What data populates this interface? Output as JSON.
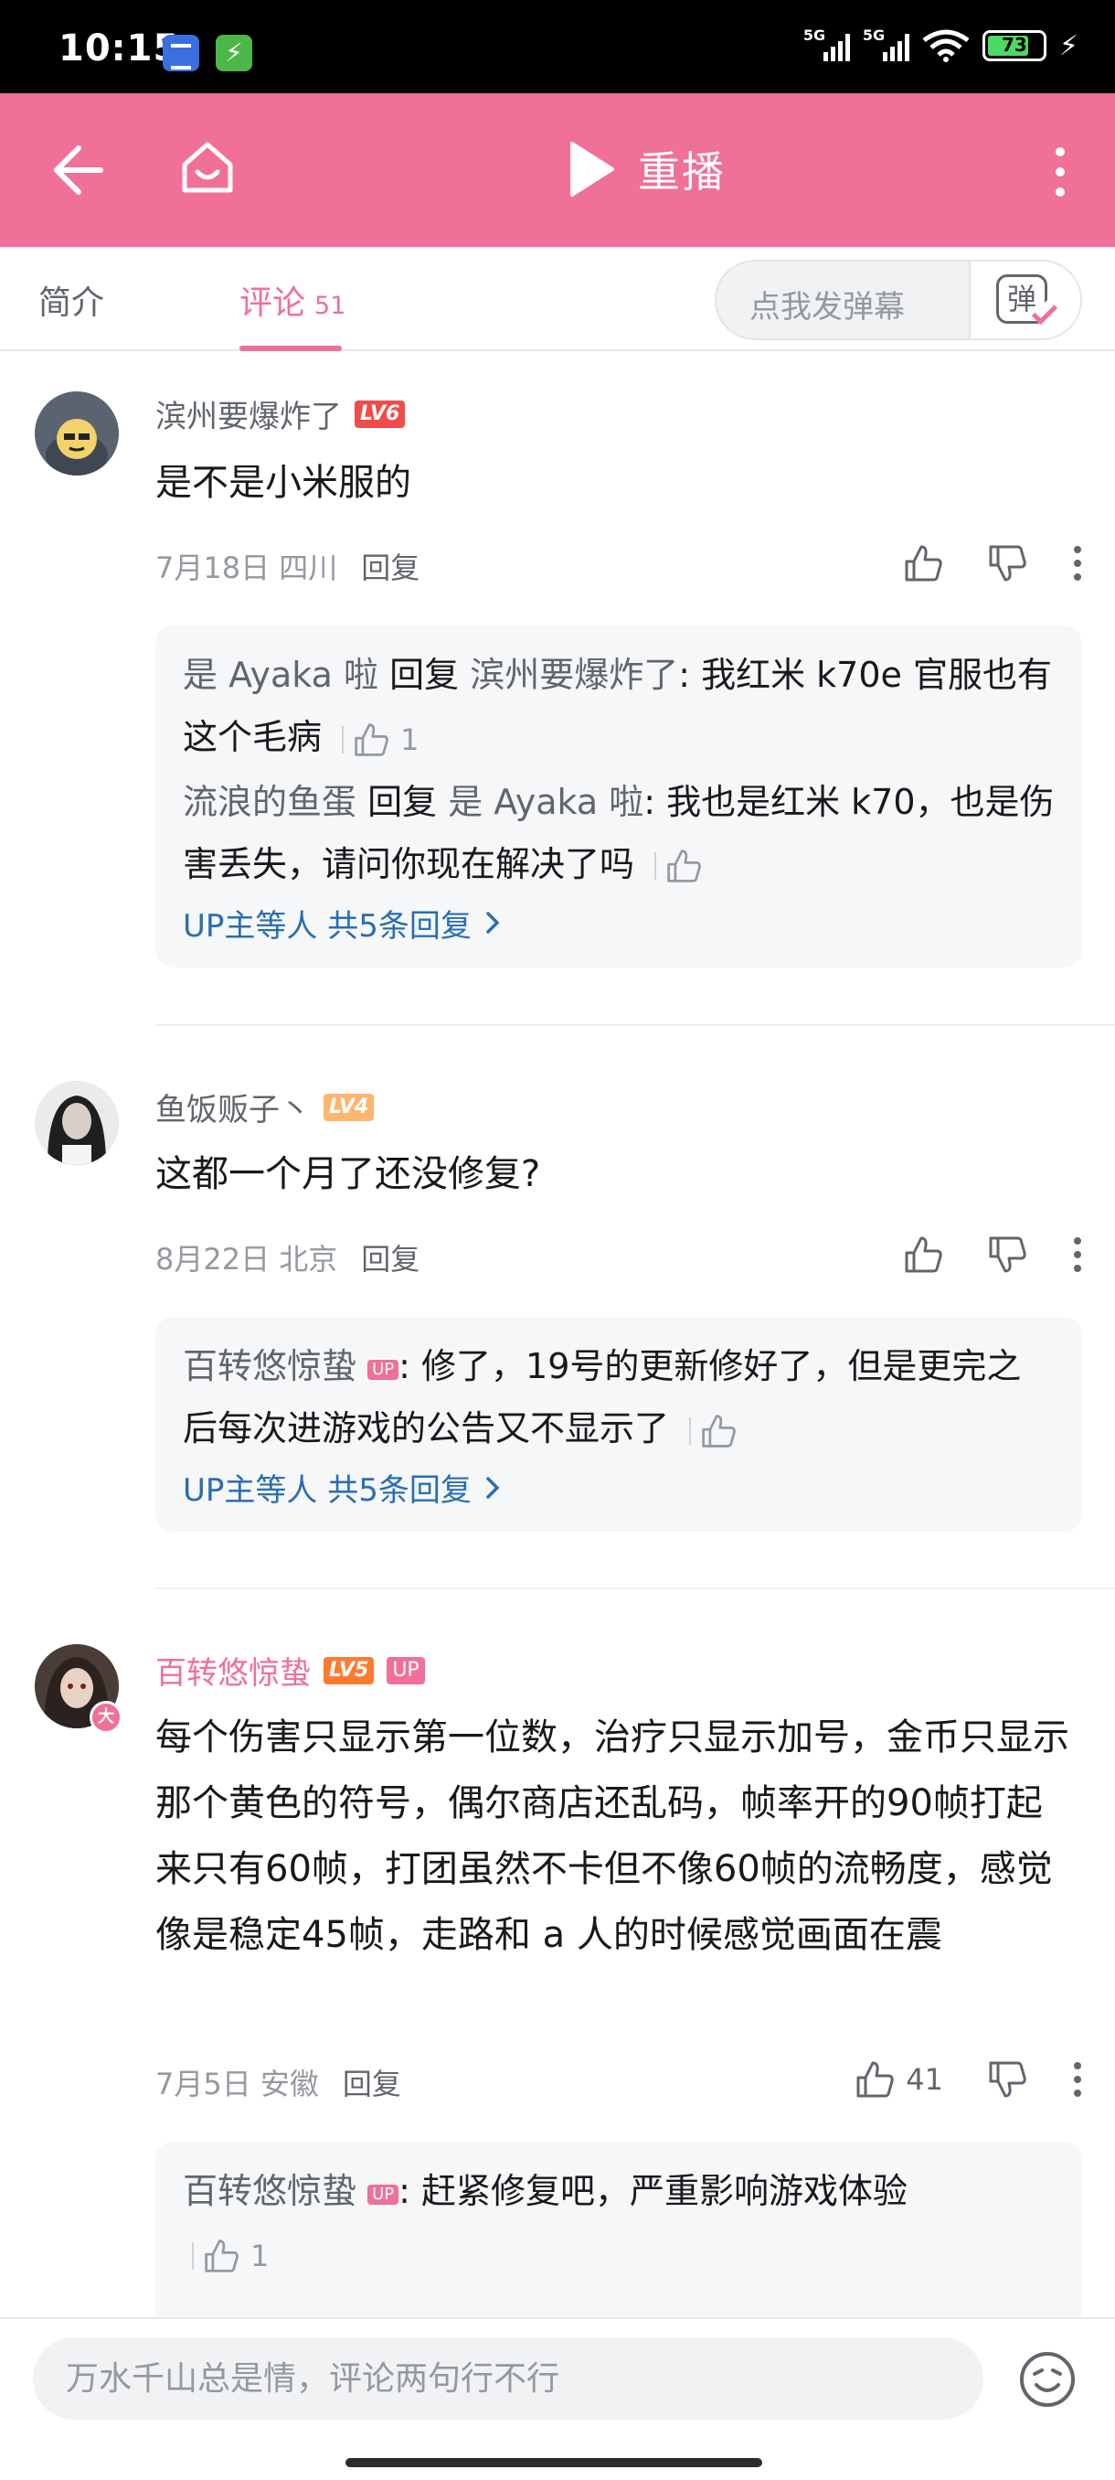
{
  "status_bar": {
    "time": "10:15",
    "network1": "5G",
    "network2": "5G",
    "battery": "73"
  },
  "header": {
    "title": "重播"
  },
  "tabs": {
    "intro": "简介",
    "comments": "评论",
    "comment_count": "51"
  },
  "danmaku": {
    "placeholder": "点我发弹幕",
    "button_glyph": "弹"
  },
  "comments": [
    {
      "user": "滨州要爆炸了",
      "level": "LV6",
      "content": "是不是小米服的",
      "date": "7月18日",
      "location": "四川",
      "reply_label": "回复",
      "likes": "",
      "replies": [
        {
          "user": "是 Ayaka 啦",
          "reply_word": "回复",
          "target": "滨州要爆炸了",
          "text": ": 我红米 k70e 官服也有这个毛病",
          "likes": "1"
        },
        {
          "user": "流浪的鱼蛋",
          "reply_word": "回复",
          "target": "是 Ayaka 啦",
          "text": ": 我也是红米 k70，也是伤害丢失，请问你现在解决了吗",
          "likes": ""
        }
      ],
      "more_replies": "UP主等人 共5条回复"
    },
    {
      "user": "鱼饭贩子丶",
      "level": "LV4",
      "content": "这都一个月了还没修复?",
      "date": "8月22日",
      "location": "北京",
      "reply_label": "回复",
      "likes": "",
      "replies": [
        {
          "user": "百转悠惊蛰",
          "up_tag": "UP",
          "text": ": 修了，19号的更新修好了，但是更完之后每次进游戏的公告又不显示了",
          "likes": ""
        }
      ],
      "more_replies": "UP主等人 共5条回复"
    },
    {
      "user": "百转悠惊蛰",
      "level": "LV5",
      "up_tag": "UP",
      "avatar_badge": "大",
      "content": "每个伤害只显示第一位数，治疗只显示加号，金币只显示那个黄色的符号，偶尔商店还乱码，帧率开的90帧打起来只有60帧，打团虽然不卡但不像60帧的流畅度，感觉像是稳定45帧，走路和 a 人的时候感觉画面在震",
      "date": "7月5日",
      "location": "安徽",
      "reply_label": "回复",
      "likes": "41",
      "replies": [
        {
          "user": "百转悠惊蛰",
          "up_tag": "UP",
          "text": ": 赶紧修复吧，严重影响游戏体验",
          "likes": "1"
        }
      ]
    }
  ],
  "input": {
    "placeholder": "万水千山总是情，评论两句行不行"
  },
  "colors": {
    "brand_pink": "#f07097",
    "link_blue": "#2a6db3"
  }
}
